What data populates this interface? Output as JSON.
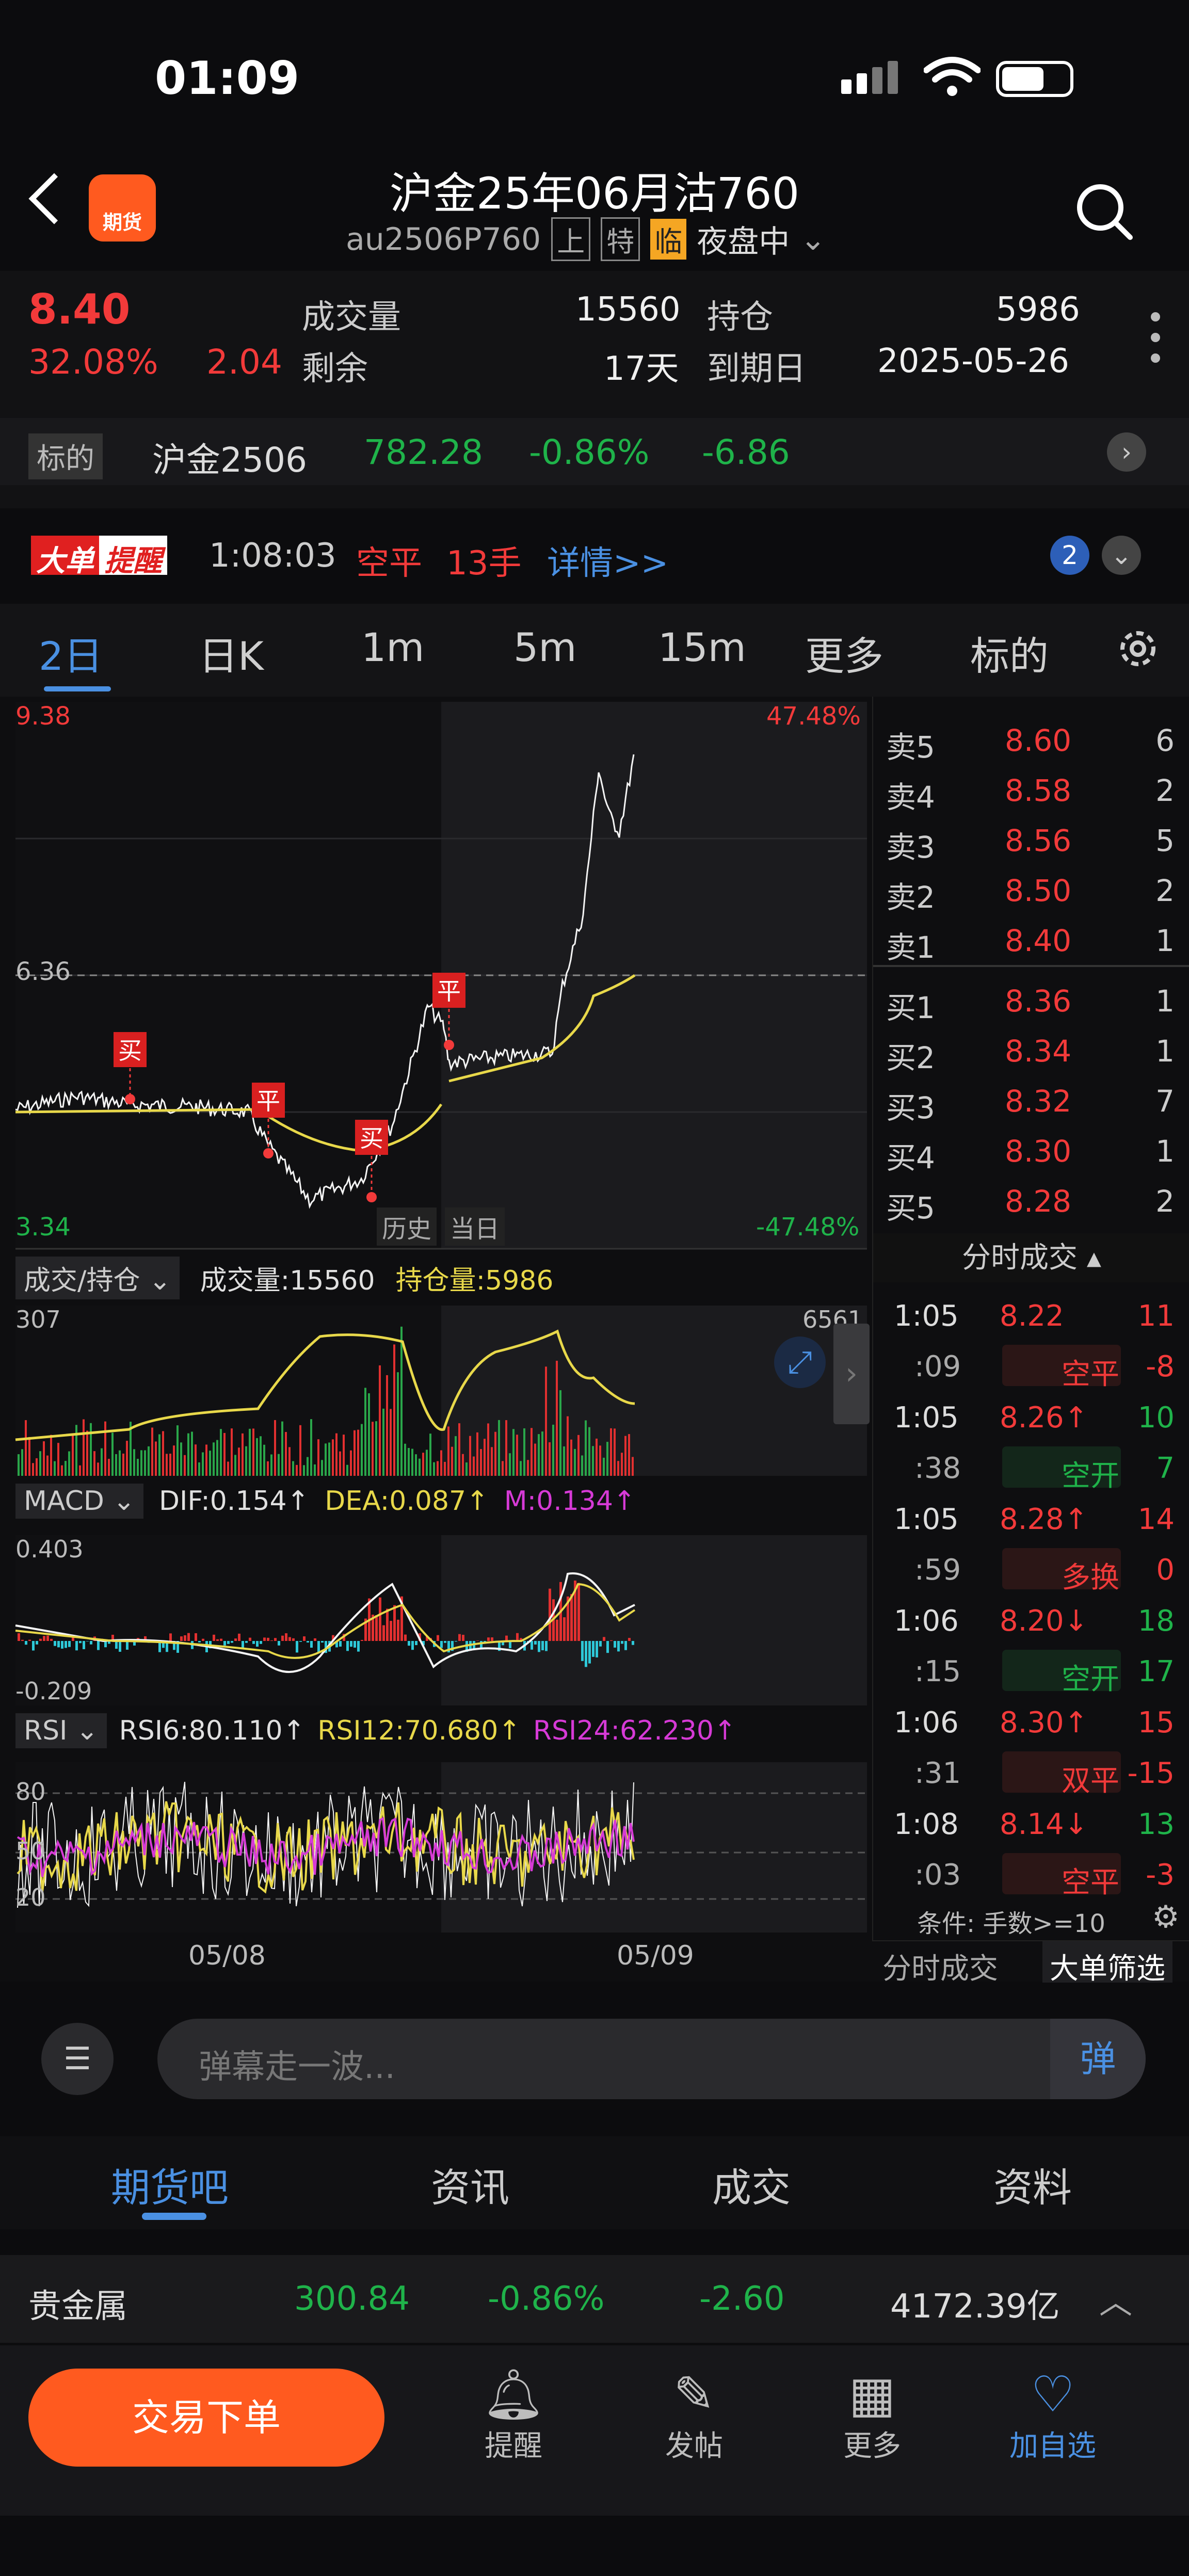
{
  "status_bar": {
    "time": "01:09"
  },
  "header": {
    "title": "沪金25年06月沽760",
    "code": "au2506P760",
    "badge_exchange": "上",
    "badge_special": "特",
    "badge_temp": "临",
    "session": "夜盘中",
    "app_icon_text": "期货"
  },
  "quote": {
    "price": "8.40",
    "change_pct": "32.08%",
    "change": "2.04",
    "volume_label": "成交量",
    "volume": "15560",
    "oi_label": "持仓",
    "oi": "5986",
    "remain_label": "剩余",
    "remain": "17天",
    "expiry_label": "到期日",
    "expiry": "2025-05-26"
  },
  "underlying": {
    "label": "标的",
    "name": "沪金2506",
    "price": "782.28",
    "pct": "-0.86%",
    "change": "-6.86"
  },
  "alert": {
    "logo_a": "大单",
    "logo_b": "提醒",
    "time": "1:08:03",
    "action": "空平",
    "lots": "13手",
    "link": "详情>>",
    "count": "2"
  },
  "chart_tabs": [
    "2日",
    "日K",
    "1m",
    "5m",
    "15m",
    "更多",
    "标的"
  ],
  "price_chart": {
    "max": "9.38",
    "mid": "6.36",
    "min": "3.34",
    "max_pct": "47.48%",
    "min_pct": "-47.48%",
    "btn_history": "历史",
    "btn_today": "当日",
    "markers": [
      {
        "label": "买"
      },
      {
        "label": "平"
      },
      {
        "label": "买"
      },
      {
        "label": "平"
      }
    ]
  },
  "volume_panel": {
    "selector": "成交/持仓",
    "vol_text": "成交量:15560",
    "oi_text": "持仓量:5986",
    "top": "307",
    "right_top": "6561"
  },
  "macd_panel": {
    "selector": "MACD",
    "dif": "DIF:0.154↑",
    "dea": "DEA:0.087↑",
    "m": "M:0.134↑",
    "top": "0.403",
    "bottom": "-0.209"
  },
  "rsi_panel": {
    "selector": "RSI",
    "rsi6": "RSI6:80.110↑",
    "rsi12": "RSI12:70.680↑",
    "rsi24": "RSI24:62.230↑",
    "l80": "80",
    "l50": "50",
    "l20": "20"
  },
  "x_dates": [
    "05/08",
    "05/09"
  ],
  "order_book": {
    "asks": [
      {
        "label": "卖5",
        "price": "8.60",
        "qty": "6"
      },
      {
        "label": "卖4",
        "price": "8.58",
        "qty": "2"
      },
      {
        "label": "卖3",
        "price": "8.56",
        "qty": "5"
      },
      {
        "label": "卖2",
        "price": "8.50",
        "qty": "2"
      },
      {
        "label": "卖1",
        "price": "8.40",
        "qty": "1"
      }
    ],
    "bids": [
      {
        "label": "买1",
        "price": "8.36",
        "qty": "1"
      },
      {
        "label": "买2",
        "price": "8.34",
        "qty": "1"
      },
      {
        "label": "买3",
        "price": "8.32",
        "qty": "7"
      },
      {
        "label": "买4",
        "price": "8.30",
        "qty": "1"
      },
      {
        "label": "买5",
        "price": "8.28",
        "qty": "2"
      }
    ]
  },
  "trades": {
    "title": "分时成交",
    "rows": [
      {
        "time": "1:05",
        "price": "8.22",
        "qty": "11",
        "sec": ":09",
        "type": "空平",
        "oi": "-8"
      },
      {
        "time": "1:05",
        "price": "8.26↑",
        "qty": "10",
        "sec": ":38",
        "type": "空开",
        "oi": "7"
      },
      {
        "time": "1:05",
        "price": "8.28↑",
        "qty": "14",
        "sec": ":59",
        "type": "多换",
        "oi": "0"
      },
      {
        "time": "1:06",
        "price": "8.20↓",
        "qty": "18",
        "sec": ":15",
        "type": "空开",
        "oi": "17"
      },
      {
        "time": "1:06",
        "price": "8.30↑",
        "qty": "15",
        "sec": ":31",
        "type": "双平",
        "oi": "-15"
      },
      {
        "time": "1:08",
        "price": "8.14↓",
        "qty": "13",
        "sec": ":03",
        "type": "空平",
        "oi": "-3"
      }
    ],
    "filter": "条件: 手数>=10",
    "tab_trades": "分时成交",
    "tab_big": "大单筛选"
  },
  "comment_input": {
    "placeholder": "弹幕走一波...",
    "btn": "弹"
  },
  "bottom_tabs": [
    "期货吧",
    "资讯",
    "成交",
    "资料"
  ],
  "sector": {
    "name": "贵金属",
    "price": "300.84",
    "pct": "-0.86%",
    "change": "-2.60",
    "amount": "4172.39亿"
  },
  "footer": {
    "trade_btn": "交易下单",
    "items": [
      "提醒",
      "发帖",
      "更多",
      "加自选"
    ]
  },
  "colors": {
    "up": "#f23a3a",
    "down": "#1fb34a",
    "accent": "#4a90e2",
    "orange": "#ff5a1f",
    "yellow": "#e8d84a",
    "magenta": "#d63ad6"
  }
}
